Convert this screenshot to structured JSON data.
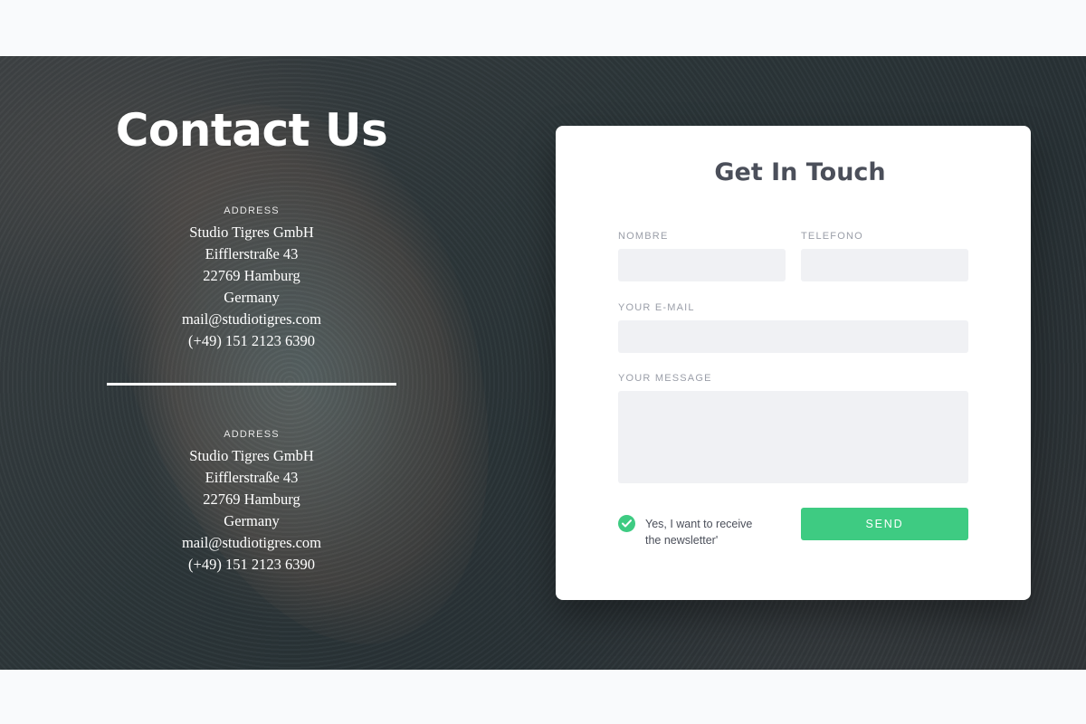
{
  "page": {
    "title": "Contact Us"
  },
  "addresses": [
    {
      "label": "ADDRESS",
      "lines": [
        "Studio Tigres GmbH",
        "Eifflerstraße 43",
        "22769 Hamburg",
        "Germany",
        "mail@studiotigres.com",
        "(+49) 151 2123 6390"
      ]
    },
    {
      "label": "ADDRESS",
      "lines": [
        "Studio Tigres GmbH",
        "Eifflerstraße 43",
        "22769 Hamburg",
        "Germany",
        "mail@studiotigres.com",
        "(+49) 151 2123 6390"
      ]
    }
  ],
  "form": {
    "title": "Get In Touch",
    "name_label": "NOMBRE",
    "name_value": "",
    "phone_label": "TELEFONO",
    "phone_value": "",
    "email_label": "YOUR E-MAIL",
    "email_value": "",
    "message_label": "YOUR MESSAGE",
    "message_value": "",
    "newsletter_checked": true,
    "newsletter_label_line1": "Yes, I want to receive",
    "newsletter_label_line2": "the newsletter'",
    "send_label": "SEND"
  },
  "colors": {
    "accent": "#3ecb82",
    "card_title": "#4b4f5a",
    "field_bg": "#f0f1f4",
    "label": "#9a9ea8"
  },
  "icons": {
    "check": "checkmark-icon"
  }
}
